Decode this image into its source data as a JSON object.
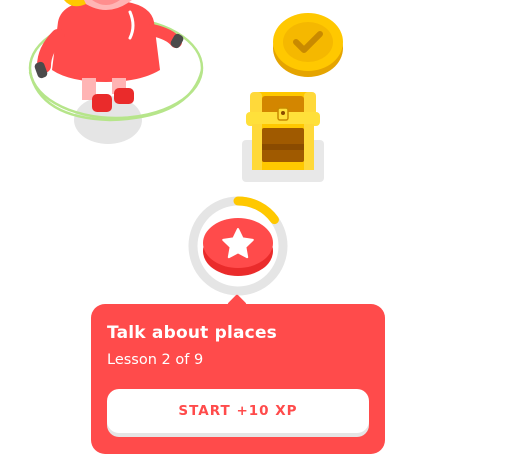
{
  "lesson_popover": {
    "title": "Talk about places",
    "subtitle": "Lesson 2 of 9",
    "start_label": "START +10 XP"
  },
  "level_node": {
    "icon": "star-icon",
    "progress_fraction": 0.15,
    "state": "active"
  },
  "path_items": [
    {
      "kind": "character",
      "icon": "jump-rope-character"
    },
    {
      "kind": "completed-coin",
      "icon": "checkmark-coin-icon"
    },
    {
      "kind": "reward",
      "icon": "treasure-chest-icon"
    }
  ],
  "colors": {
    "accent_red": "#ff4b4b",
    "accent_red_dark": "#ea2b2b",
    "gold": "#ffc800",
    "ring_gray": "#e5e5e5",
    "white": "#ffffff"
  }
}
